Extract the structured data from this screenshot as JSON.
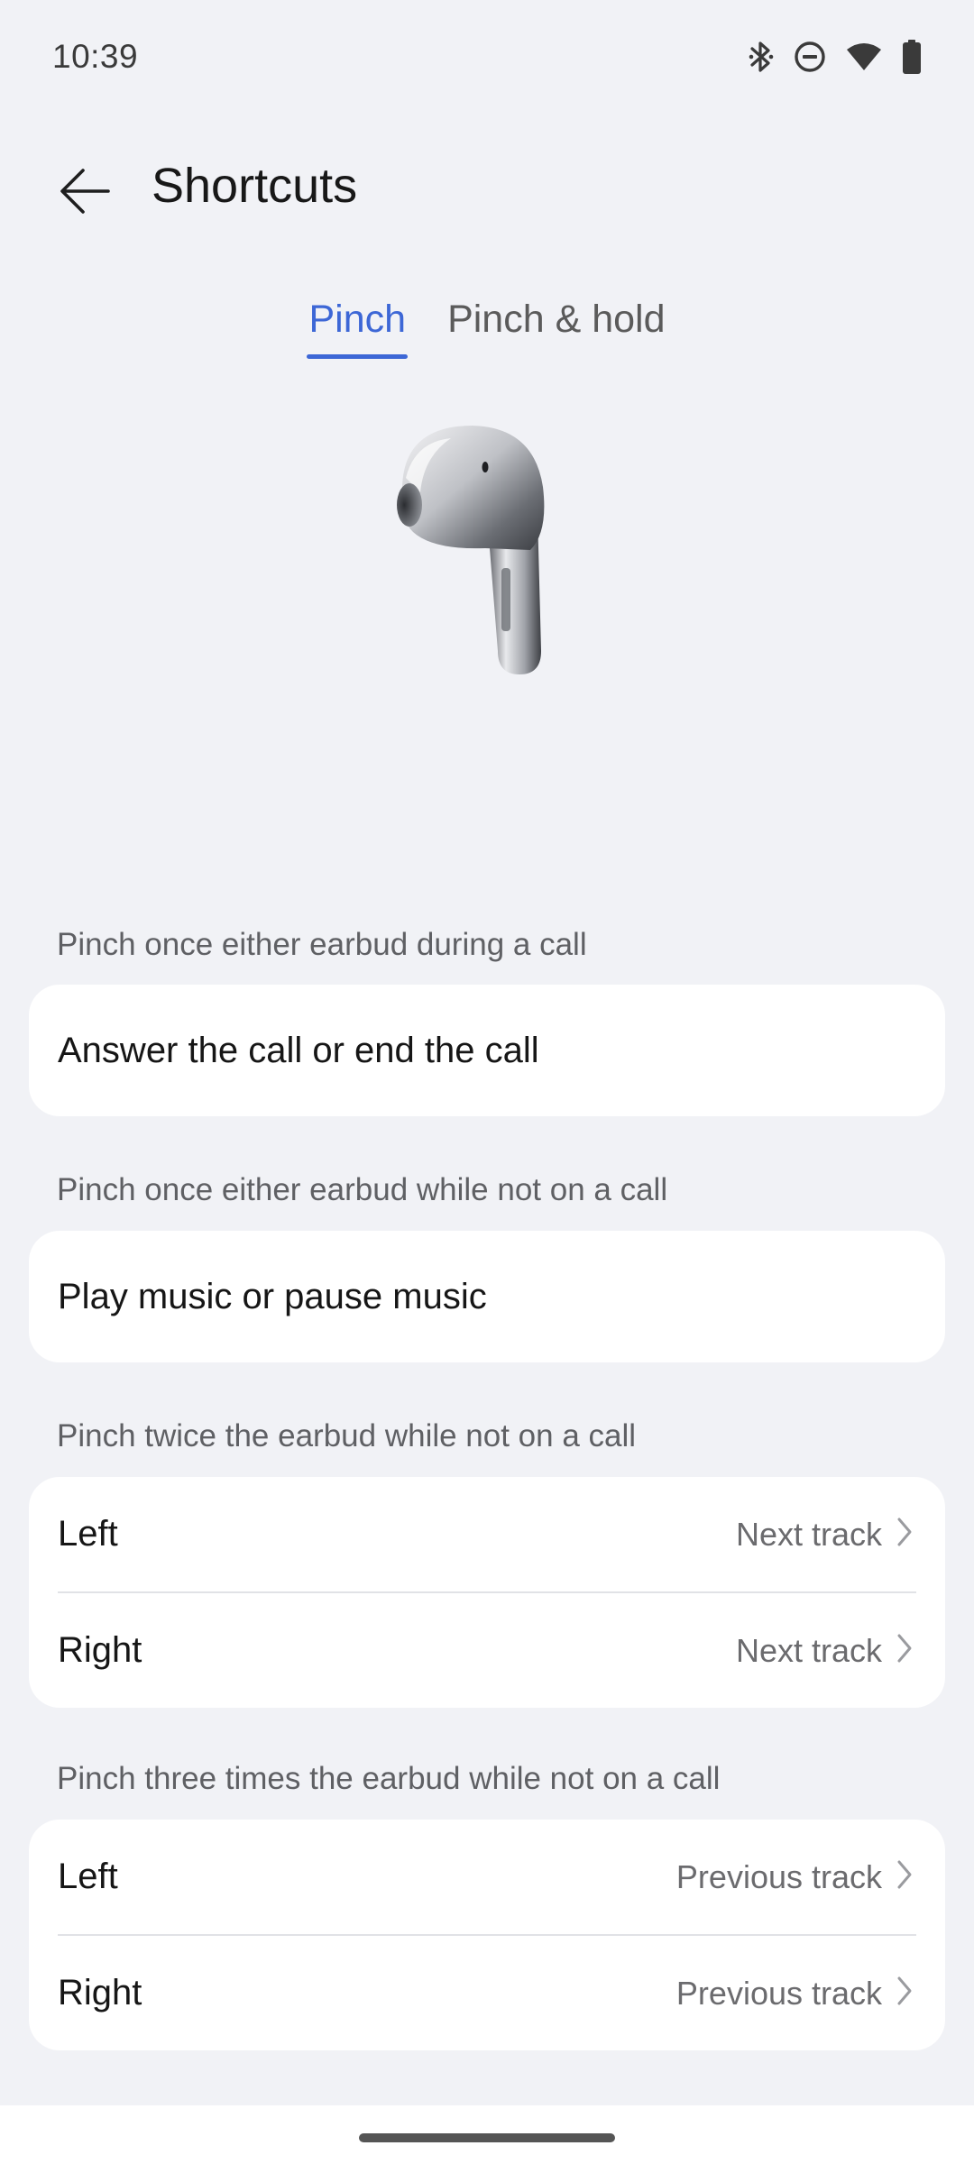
{
  "status_bar": {
    "time": "10:39",
    "icons": [
      "bluetooth-icon",
      "do-not-disturb-icon",
      "wifi-icon",
      "battery-icon"
    ]
  },
  "header": {
    "title": "Shortcuts",
    "back_icon": "arrow-left-icon"
  },
  "tabs": [
    {
      "label": "Pinch",
      "active": true
    },
    {
      "label": "Pinch & hold",
      "active": false
    }
  ],
  "sections": [
    {
      "label": "Pinch once either earbud during a call",
      "rows": [
        {
          "title": "Answer the call or end the call"
        }
      ]
    },
    {
      "label": "Pinch once either earbud while not on a call",
      "rows": [
        {
          "title": "Play music or pause music"
        }
      ]
    },
    {
      "label": "Pinch twice the earbud while not on a call",
      "rows": [
        {
          "title": "Left",
          "value": "Next track"
        },
        {
          "title": "Right",
          "value": "Next track"
        }
      ]
    },
    {
      "label": "Pinch three times the earbud while not on a call",
      "rows": [
        {
          "title": "Left",
          "value": "Previous track"
        },
        {
          "title": "Right",
          "value": "Previous track"
        }
      ]
    }
  ],
  "colors": {
    "accent": "#3d67d6",
    "background": "#f1f2f6",
    "card": "#ffffff"
  }
}
